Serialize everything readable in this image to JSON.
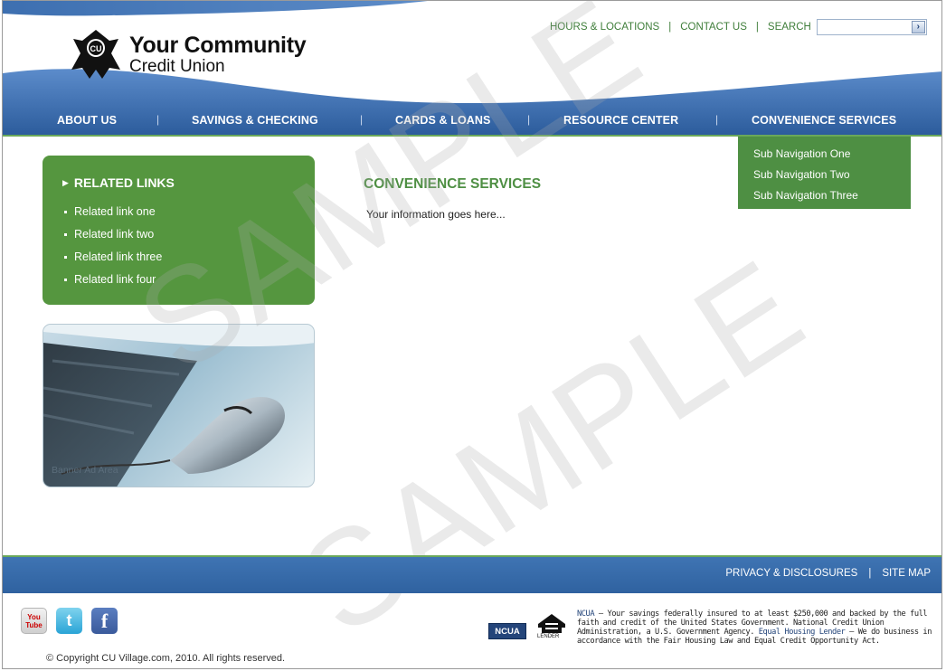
{
  "brand": {
    "name_line1": "Your Community",
    "name_line2": "Credit Union",
    "mark_text": "CU"
  },
  "utility_nav": {
    "hours": "HOURS & LOCATIONS",
    "contact": "CONTACT US",
    "search": "SEARCH",
    "separator": "|",
    "search_value": "",
    "search_go": "›"
  },
  "main_nav": {
    "items": [
      {
        "label": "ABOUT US"
      },
      {
        "label": "SAVINGS & CHECKING"
      },
      {
        "label": "CARDS & LOANS"
      },
      {
        "label": "RESOURCE CENTER"
      },
      {
        "label": "CONVENIENCE SERVICES",
        "active": true
      }
    ],
    "separator": "|"
  },
  "sub_nav": {
    "items": [
      "Sub Navigation One",
      "Sub Navigation Two",
      "Sub Navigation Three"
    ]
  },
  "sidebar": {
    "related_title": "RELATED LINKS",
    "related_links": [
      "Related link one",
      "Related link two",
      "Related link three",
      "Related link four"
    ],
    "banner_label": "Banner Ad Area"
  },
  "content": {
    "title": "CONVENIENCE SERVICES",
    "body": "Your information goes here..."
  },
  "watermark": {
    "text": "SAMPLE"
  },
  "footer": {
    "privacy": "PRIVACY & DISCLOSURES",
    "separator": "|",
    "sitemap": "SITE MAP",
    "copyright": "© Copyright CU Village.com, 2010. All rights reserved.",
    "ncua_badge": "NCUA",
    "ehl_caption": "LENDER",
    "disclaimer": {
      "ncua_word": "NCUA",
      "part1": " — Your savings federally insured to at least $250,000 and backed by the full faith and credit of the United States Government. National Credit Union Administration, a U.S. Government Agency. ",
      "ehl_word": "Equal Housing Lender",
      "part2": " — We do business in accordance with the Fair Housing Law and Equal Credit Opportunity Act."
    },
    "social": {
      "youtube": "You Tube",
      "twitter": "t",
      "facebook": "f"
    }
  },
  "colors": {
    "nav_blue": "#2f62a0",
    "accent_green": "#55963f",
    "dark_blue": "#24457a"
  }
}
